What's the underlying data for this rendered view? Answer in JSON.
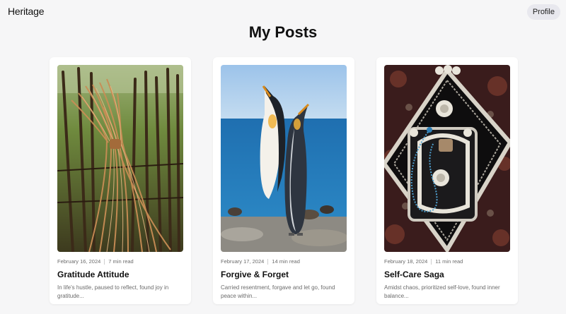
{
  "header": {
    "brand": "Heritage",
    "profile_label": "Profile"
  },
  "page": {
    "title": "My Posts"
  },
  "posts": [
    {
      "date": "February 16, 2024",
      "read_time": "7 min read",
      "title": "Gratitude Attitude",
      "excerpt": "In life's hustle, paused to reflect, found joy in gratitude..."
    },
    {
      "date": "February 17, 2024",
      "read_time": "14 min read",
      "title": "Forgive & Forget",
      "excerpt": "Carried resentment, forgave and let go, found peace within..."
    },
    {
      "date": "February 18, 2024",
      "read_time": "11 min read",
      "title": "Self-Care Saga",
      "excerpt": "Amidst chaos, prioritized self-love, found inner balance..."
    }
  ]
}
